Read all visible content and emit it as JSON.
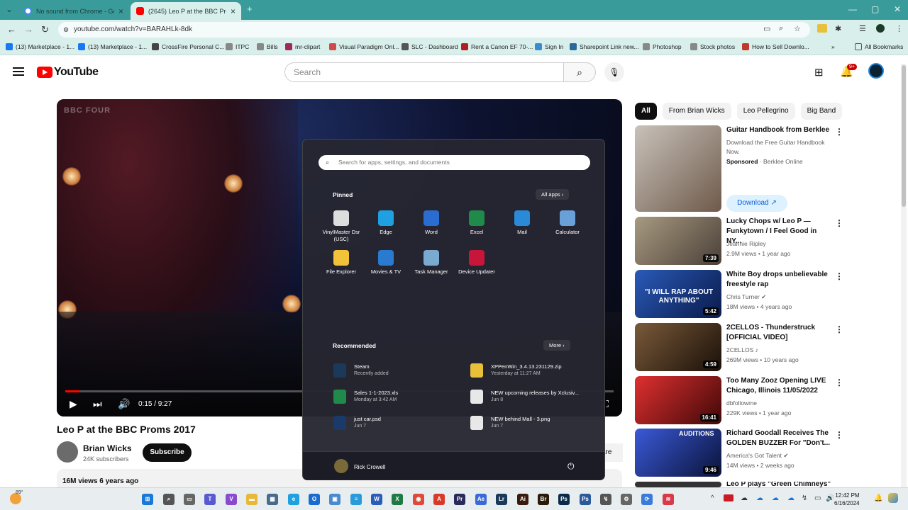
{
  "browser": {
    "tabs": [
      {
        "title": "No sound from Chrome - Goo",
        "close": "×"
      },
      {
        "title": "(2645) Leo P at the BBC Proms",
        "close": "×"
      }
    ],
    "new_tab": "+",
    "url": "youtube.com/watch?v=BARAHLk-8dk",
    "window_controls": {
      "minimize": "—",
      "maximize": "▢",
      "close": "✕"
    },
    "nav": {
      "back": "←",
      "forward": "→",
      "reload": "↻"
    },
    "bookmarks": [
      {
        "label": "(13) Marketplace - 1...",
        "color": "#1877f2"
      },
      {
        "label": "(13) Marketplace - 1...",
        "color": "#1877f2"
      },
      {
        "label": "CrossFire Personal C...",
        "color": "#444444"
      },
      {
        "label": "ITPC",
        "color": "#888888"
      },
      {
        "label": "Bills",
        "color": "#888888"
      },
      {
        "label": "mr-clipart",
        "color": "#a0285a"
      },
      {
        "label": "Visual Paradigm Onl...",
        "color": "#d04a4a"
      },
      {
        "label": "SLC - Dashboard",
        "color": "#555555"
      },
      {
        "label": "Rent a Canon EF 70-...",
        "color": "#b02020"
      },
      {
        "label": "Sign In",
        "color": "#3a8ad0"
      },
      {
        "label": "Sharepoint Link new...",
        "color": "#2a6a9a"
      },
      {
        "label": "Photoshop",
        "color": "#888888"
      },
      {
        "label": "Stock photos",
        "color": "#888888"
      },
      {
        "label": "How to Sell Downlo...",
        "color": "#c0392b"
      }
    ],
    "bookmarks_more": "»",
    "all_bookmarks": "All Bookmarks"
  },
  "youtube": {
    "logo_text": "YouTube",
    "search_placeholder": "Search",
    "notif_count": "9+",
    "video": {
      "time": "0:15 / 9:27",
      "progress": 0.026,
      "title": "Leo P at the BBC Proms 2017",
      "channel": "Brian Wicks",
      "subscribers": "24K subscribers",
      "subscribe_label": "Subscribe",
      "share_label": "are",
      "views_age": "16M views  6 years ago"
    },
    "chips": [
      "All",
      "From Brian Wicks",
      "Leo Pellegrino",
      "Big Band"
    ],
    "recommendations": [
      {
        "title": "Guitar Handbook from Berklee",
        "desc": "Download the Free Guitar Handbook Now.",
        "sponsored": "Sponsored",
        "advertiser": "· Berklee Online",
        "button": "Download",
        "thumb": "#6e5a4a"
      },
      {
        "title": "Lucky Chops w/ Leo P — Funkytown / I Feel Good in NY...",
        "channel": "Jeannie Ripley",
        "meta": "2.9M views  •  1 year ago",
        "duration": "7:39",
        "thumb": "#7d7464"
      },
      {
        "title": "White Boy drops unbelievable freestyle rap",
        "channel": "Chris Turner ✔",
        "meta": "18M views  •  4 years ago",
        "duration": "5:42",
        "thumb": "#1a3a7a",
        "overlay": "\"I WILL RAP ABOUT ANYTHING\""
      },
      {
        "title": "2CELLOS - Thunderstruck [OFFICIAL VIDEO]",
        "channel": "2CELLOS ♪",
        "meta": "269M views  •  10 years ago",
        "duration": "4:59",
        "thumb": "#4a3020"
      },
      {
        "title": "Too Many Zooz Opening LIVE Chicago, Illinois 11/05/2022",
        "channel": "dbfollowme",
        "meta": "229K views  •  1 year ago",
        "duration": "16:41",
        "thumb": "#a01818"
      },
      {
        "title": "Richard Goodall Receives The GOLDEN BUZZER For \"Don't...",
        "channel": "America's Got Talent ✔",
        "meta": "14M views  •  2 weeks ago",
        "duration": "9:46",
        "thumb": "#2a3a8a",
        "overlay": "AUDITIONS"
      },
      {
        "title": "Leo P plays \"Green Chimneys\"",
        "thumb": "#333333"
      }
    ]
  },
  "start_menu": {
    "search_placeholder": "Search for apps, settings, and documents",
    "pinned_label": "Pinned",
    "all_apps": "All apps  ›",
    "pinned": [
      {
        "name": "VinylMaster Dsr (USC)",
        "color": "#dddddd"
      },
      {
        "name": "Edge",
        "color": "#1fa0e0"
      },
      {
        "name": "Word",
        "color": "#2b6cd0"
      },
      {
        "name": "Excel",
        "color": "#1f8a4a"
      },
      {
        "name": "Mail",
        "color": "#2a8ad8"
      },
      {
        "name": "Calculator",
        "color": "#6aa0d8"
      },
      {
        "name": "File Explorer",
        "color": "#f2c23a"
      },
      {
        "name": "Movies & TV",
        "color": "#2a7ad0"
      },
      {
        "name": "Task Manager",
        "color": "#7aaad0"
      },
      {
        "name": "Device Updater",
        "color": "#c8163a"
      }
    ],
    "recommended_label": "Recommended",
    "more": "More  ›",
    "recommended": [
      {
        "name": "Steam",
        "detail": "Recently added",
        "color": "#1b3a5a"
      },
      {
        "name": "XPPenWin_3.4.13.231129.zip",
        "detail": "Yesterday at 11:27 AM",
        "color": "#e8c03a"
      },
      {
        "name": "Sales 1-1-2023.xls",
        "detail": "Monday at 3:42 AM",
        "color": "#1f8a4a"
      },
      {
        "name": "NEW upcoming releases by Xclusiv...",
        "detail": "Jun 8",
        "color": "#e8e8e8"
      },
      {
        "name": "just car.psd",
        "detail": "Jun 7",
        "color": "#1a3a6a"
      },
      {
        "name": "NEW behind Mall - 3.png",
        "detail": "Jun 7",
        "color": "#e8e8e8"
      }
    ],
    "user": "Rick Crowell",
    "power": "⏻"
  },
  "taskbar": {
    "weather": "89°",
    "time": "12:42 PM",
    "date": "6/16/2024",
    "icons": [
      {
        "name": "start",
        "color": "#1a78d8",
        "glyph": "⊞"
      },
      {
        "name": "search",
        "color": "#555555",
        "glyph": "⌕"
      },
      {
        "name": "task-view",
        "color": "#666666",
        "glyph": "▭"
      },
      {
        "name": "teams",
        "color": "#5a5ad0",
        "glyph": "T"
      },
      {
        "name": "visual-studio",
        "color": "#8a4ad0",
        "glyph": "V"
      },
      {
        "name": "file-explorer",
        "color": "#e8b83a",
        "glyph": "▬"
      },
      {
        "name": "calculator",
        "color": "#4a6a8a",
        "glyph": "▦"
      },
      {
        "name": "edge",
        "color": "#1fa0e0",
        "glyph": "e"
      },
      {
        "name": "outlook",
        "color": "#1a6ad0",
        "glyph": "O"
      },
      {
        "name": "photos",
        "color": "#4a8ad0",
        "glyph": "▣"
      },
      {
        "name": "notepad",
        "color": "#2a9ad8",
        "glyph": "≡"
      },
      {
        "name": "word",
        "color": "#2b5cb8",
        "glyph": "W"
      },
      {
        "name": "excel",
        "color": "#1f7a44",
        "glyph": "X"
      },
      {
        "name": "chrome",
        "color": "#e04a3a",
        "glyph": "◉"
      },
      {
        "name": "acrobat",
        "color": "#d83a2a",
        "glyph": "A"
      },
      {
        "name": "premiere",
        "color": "#2a2a5a",
        "glyph": "Pr"
      },
      {
        "name": "adobe-express",
        "color": "#3a6ad8",
        "glyph": "Ae"
      },
      {
        "name": "lightroom",
        "color": "#1a3a5a",
        "glyph": "Lr"
      },
      {
        "name": "illustrator",
        "color": "#3a1a0a",
        "glyph": "Ai"
      },
      {
        "name": "bridge",
        "color": "#2a1a0a",
        "glyph": "Br"
      },
      {
        "name": "photoshop",
        "color": "#0a2a4a",
        "glyph": "Ps"
      },
      {
        "name": "photoshop-2",
        "color": "#2a5a9a",
        "glyph": "Ps"
      },
      {
        "name": "usb",
        "color": "#555555",
        "glyph": "↯"
      },
      {
        "name": "settings",
        "color": "#666666",
        "glyph": "⚙"
      },
      {
        "name": "sync",
        "color": "#3a7ad8",
        "glyph": "⟳"
      },
      {
        "name": "app-red",
        "color": "#d83a4a",
        "glyph": "≋"
      }
    ]
  }
}
